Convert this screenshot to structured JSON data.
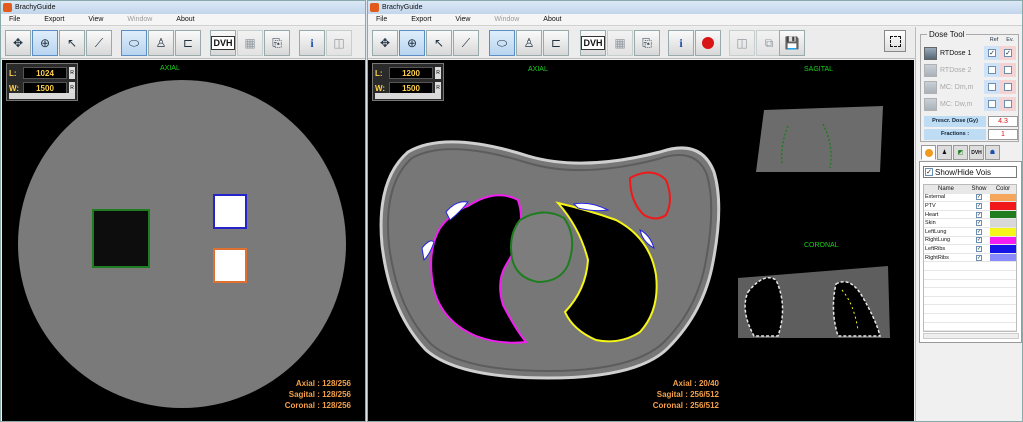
{
  "windows": [
    {
      "title": "BrachyGuide",
      "menu": [
        {
          "label": "File",
          "enabled": true
        },
        {
          "label": "Export",
          "enabled": true
        },
        {
          "label": "View",
          "enabled": true
        },
        {
          "label": "Window",
          "enabled": false
        },
        {
          "label": "About",
          "enabled": true
        }
      ],
      "window_level": {
        "L_label": "L:",
        "L_value": "1024",
        "W_label": "W:",
        "W_value": "1500",
        "spin": "R"
      },
      "view_label": "AXIAL",
      "slice_info": [
        "Axial : 128/256",
        "Sagital : 128/256",
        "Coronal : 128/256"
      ]
    },
    {
      "title": "BrachyGuide",
      "menu": [
        {
          "label": "File",
          "enabled": true
        },
        {
          "label": "Export",
          "enabled": true
        },
        {
          "label": "View",
          "enabled": true
        },
        {
          "label": "Window",
          "enabled": false
        },
        {
          "label": "About",
          "enabled": true
        }
      ],
      "window_level": {
        "L_label": "L:",
        "L_value": "1200",
        "W_label": "W:",
        "W_value": "1500",
        "spin": "R"
      },
      "view_labels": {
        "axial": "AXIAL",
        "sagital": "SAGITAL",
        "coronal": "CORONAL"
      },
      "slice_info": [
        "Axial : 20/40",
        "Sagital : 256/512",
        "Coronal : 256/512"
      ]
    }
  ],
  "toolbar": {
    "dvh_label": "DVH",
    "info_label": "i"
  },
  "dose_tool": {
    "title": "Dose Tool",
    "col_ref": "Ref",
    "col_ev": "Ev.",
    "doses": [
      {
        "name": "RTDose 1",
        "enabled": true,
        "ref": true,
        "ev": true
      },
      {
        "name": "RTDose 2",
        "enabled": false,
        "ref": false,
        "ev": false
      },
      {
        "name": "MC: Dm,m",
        "enabled": false,
        "ref": false,
        "ev": false
      },
      {
        "name": "MC: Dw,m",
        "enabled": false,
        "ref": false,
        "ev": false
      }
    ],
    "prescr_label": "Prescr. Dose (Gy)",
    "prescr_value": "4.3",
    "fractions_label": "Fractions :",
    "fractions_value": "1"
  },
  "vois": {
    "show_hide_label": "Show/Hide Vois",
    "headers": [
      "Name",
      "Show",
      "Color"
    ],
    "rows": [
      {
        "name": "External",
        "show": true,
        "color": "#f5a65a"
      },
      {
        "name": "PTV",
        "show": true,
        "color": "#f01818"
      },
      {
        "name": "Heart",
        "show": true,
        "color": "#1f7d1f"
      },
      {
        "name": "Skin",
        "show": true,
        "color": "#d8d8d8"
      },
      {
        "name": "LeftLung",
        "show": true,
        "color": "#f5f51a"
      },
      {
        "name": "RightLung",
        "show": true,
        "color": "#f21ef2"
      },
      {
        "name": "LeftRibs",
        "show": true,
        "color": "#1414e6"
      },
      {
        "name": "RightRibs",
        "show": true,
        "color": "#8a8aff"
      }
    ]
  }
}
